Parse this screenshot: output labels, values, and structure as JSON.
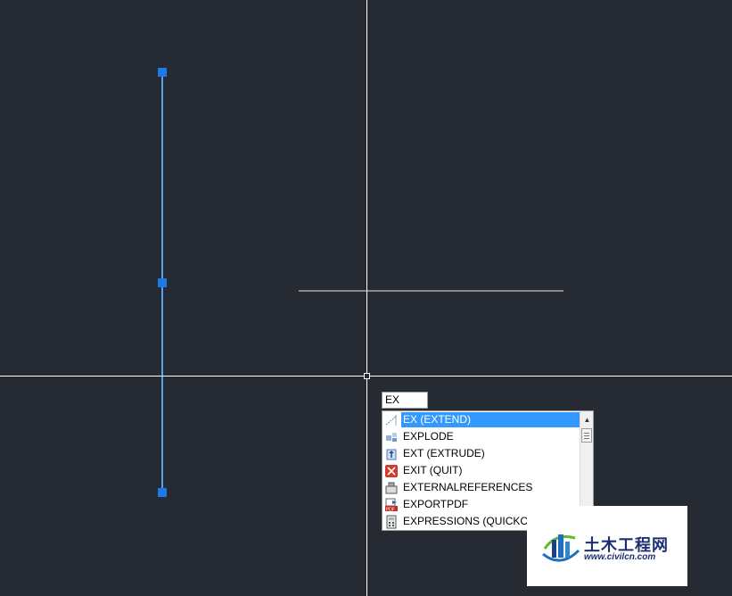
{
  "canvas": {
    "background": "#252a33",
    "crosshair_color": "#ffffff",
    "selected_line_color": "#3a8fe8",
    "grip_color": "#1e7ae6"
  },
  "command_line": {
    "input_value": "EX"
  },
  "autocomplete": {
    "items": [
      {
        "label": "EX (EXTEND)",
        "icon": "extend-icon",
        "selected": true
      },
      {
        "label": "EXPLODE",
        "icon": "explode-icon",
        "selected": false
      },
      {
        "label": "EXT (EXTRUDE)",
        "icon": "extrude-icon",
        "selected": false
      },
      {
        "label": "EXIT (QUIT)",
        "icon": "quit-icon",
        "selected": false
      },
      {
        "label": "EXTERNALREFERENCES",
        "icon": "external-references-icon",
        "selected": false
      },
      {
        "label": "EXPORTPDF",
        "icon": "pdf-icon",
        "selected": false
      },
      {
        "label": "EXPRESSIONS (QUICKCALC)",
        "icon": "calculator-icon",
        "selected": false
      }
    ],
    "selected_color": "#3399ff"
  },
  "watermark": {
    "title": "土木工程网",
    "url": "www.civilcn.com",
    "icon": "building-logo-icon"
  }
}
